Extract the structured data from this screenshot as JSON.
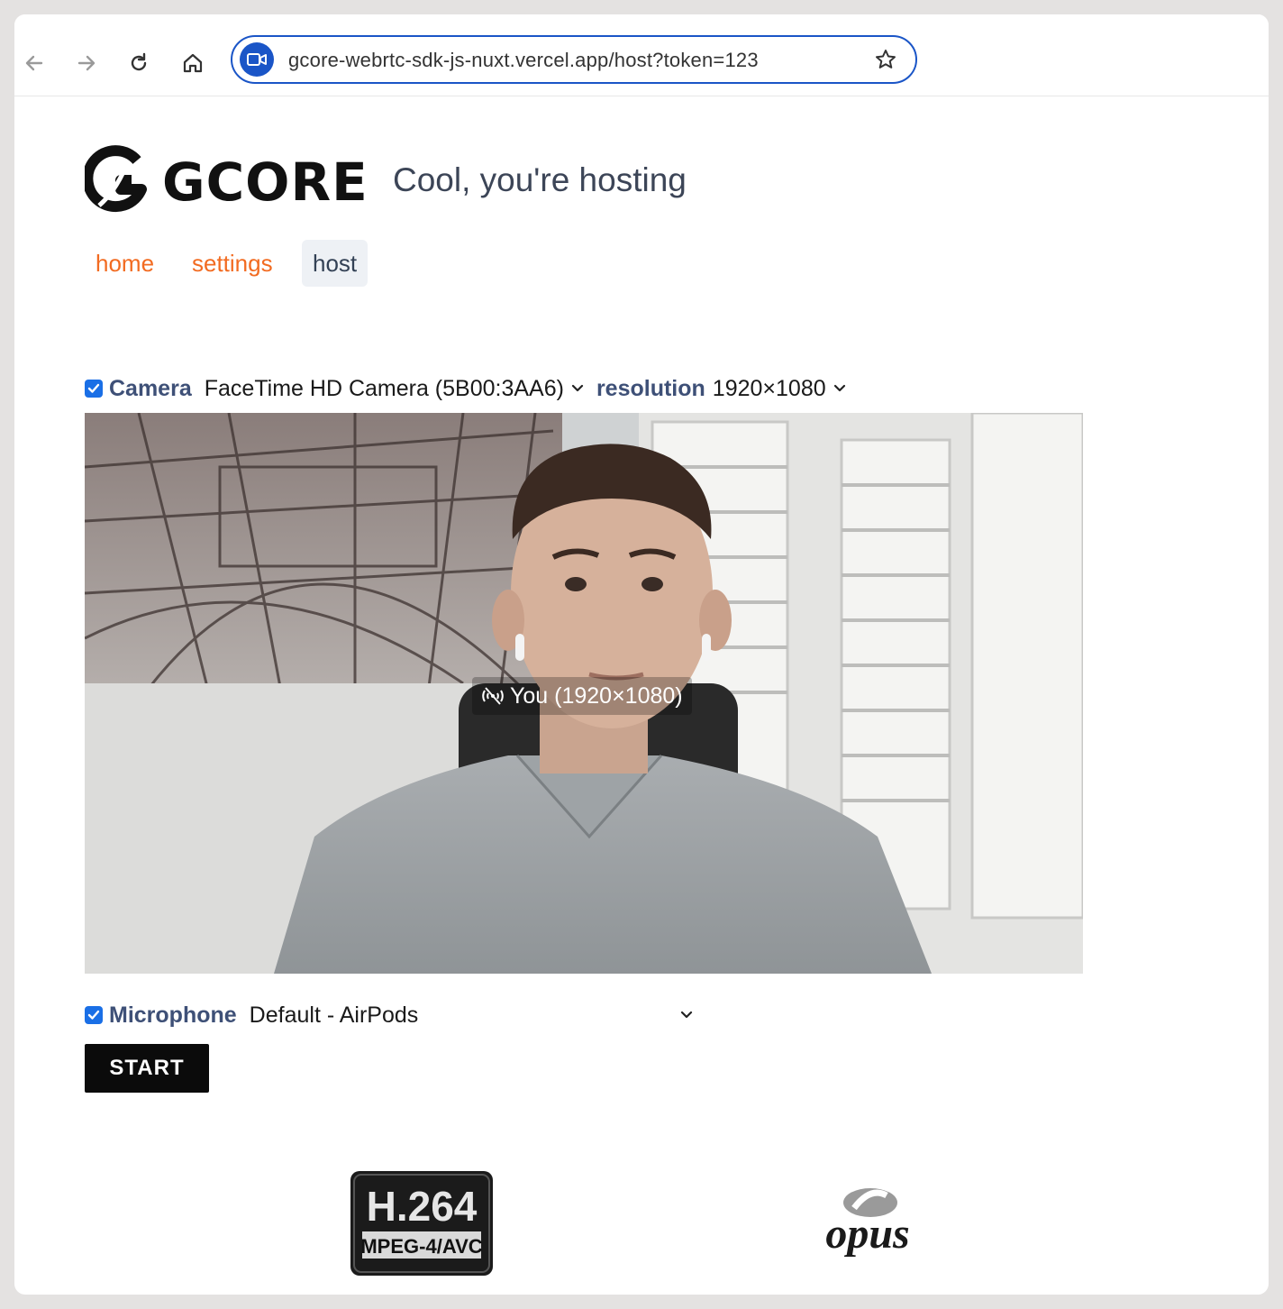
{
  "browser": {
    "url": "gcore-webrtc-sdk-js-nuxt.vercel.app/host?token=123",
    "accent": "#1a55c7"
  },
  "header": {
    "logo_text": "GCORE",
    "subtitle": "Cool, you're hosting"
  },
  "nav": {
    "items": [
      {
        "label": "home",
        "active": false
      },
      {
        "label": "settings",
        "active": false
      },
      {
        "label": "host",
        "active": true
      }
    ],
    "link_color": "#f26b21"
  },
  "camera": {
    "checked": true,
    "label": "Camera",
    "device": "FaceTime HD Camera (5B00:3AA6)",
    "resolution_label": "resolution",
    "resolution": "1920×1080"
  },
  "video": {
    "overlay_label": "You (1920×1080)"
  },
  "microphone": {
    "checked": true,
    "label": "Microphone",
    "device": "Default - AirPods"
  },
  "actions": {
    "start_label": "START"
  },
  "codecs": {
    "video_logo_main": "H.264",
    "video_logo_sub": "MPEG-4/AVC",
    "audio_logo": "opus"
  }
}
